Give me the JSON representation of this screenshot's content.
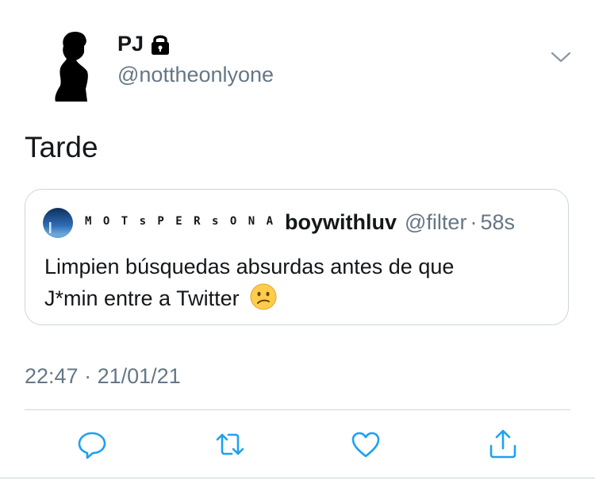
{
  "author": {
    "display_name": "PJ",
    "handle": "@nottheonlyone",
    "icons": {
      "avatar": "silhouette-avatar",
      "protected": "lock-icon",
      "menu": "chevron-down-icon"
    }
  },
  "tweet": {
    "text": "Tarde",
    "time": "22:47",
    "separator": "·",
    "date": "21/01/21"
  },
  "quote": {
    "display_name": "M O T s P E R s O N A",
    "username": "boywithluv",
    "handle": "@filter",
    "separator": "·",
    "time": "58s",
    "text_line1": "Limpien búsquedas absurdas antes de que",
    "text_line2": "J*min entre a Twitter",
    "emoji": "confused-face-emoji"
  },
  "actions": {
    "icons": [
      "reply-icon",
      "retweet-icon",
      "like-icon",
      "share-icon"
    ]
  },
  "colors": {
    "text": "#14171a",
    "secondary": "#657786",
    "border": "#ccd6dd",
    "icon": "#1da1f2"
  }
}
